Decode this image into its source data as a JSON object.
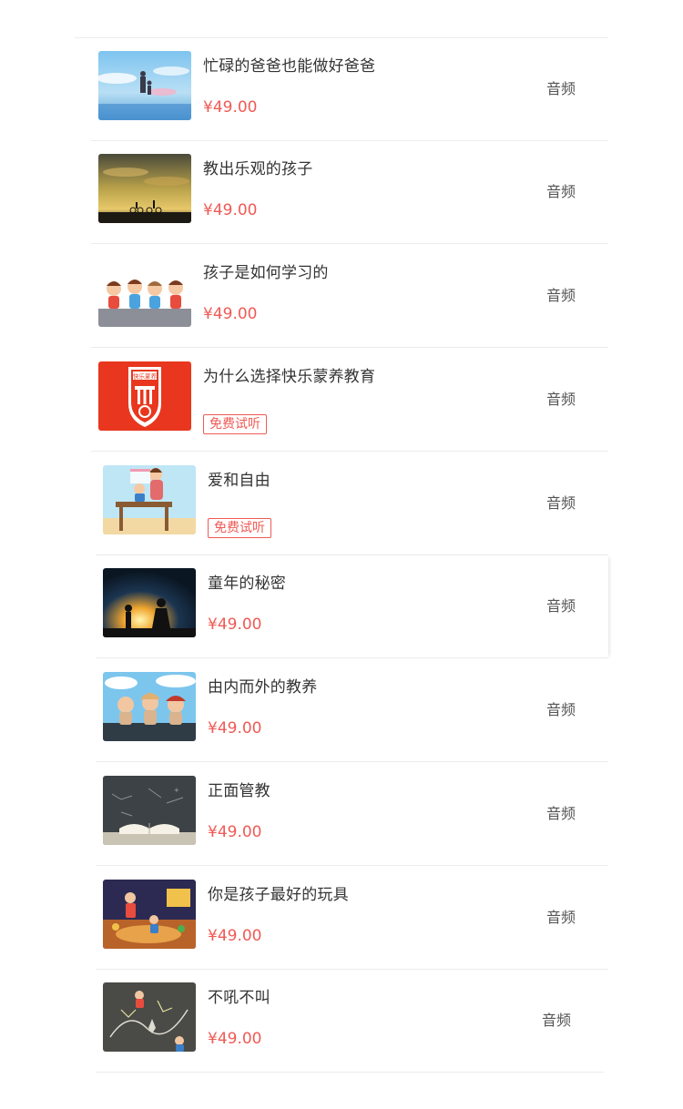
{
  "courses": [
    {
      "title": "忙碌的爸爸也能做好爸爸",
      "price": "¥49.00",
      "badge": null,
      "type": "音频",
      "thumb": "father-child-sky"
    },
    {
      "title": "教出乐观的孩子",
      "price": "¥49.00",
      "badge": null,
      "type": "音频",
      "thumb": "sunset-cyclists"
    },
    {
      "title": "孩子是如何学习的",
      "price": "¥49.00",
      "badge": null,
      "type": "音频",
      "thumb": "cartoon-kids"
    },
    {
      "title": "为什么选择快乐蒙养教育",
      "price": null,
      "badge": "免费试听",
      "type": "音频",
      "thumb": "kuaile-mengyang-logo",
      "logo_text": "快乐蒙养"
    },
    {
      "title": "爱和自由",
      "price": null,
      "badge": "免费试听",
      "type": "音频",
      "thumb": "mother-child-table"
    },
    {
      "title": "童年的秘密",
      "price": "¥49.00",
      "badge": null,
      "type": "音频",
      "thumb": "silhouette-night"
    },
    {
      "title": "由内而外的教养",
      "price": "¥49.00",
      "badge": null,
      "type": "音频",
      "thumb": "kids-on-wall"
    },
    {
      "title": "正面管教",
      "price": "¥49.00",
      "badge": null,
      "type": "音频",
      "thumb": "book-chalkboard"
    },
    {
      "title": "你是孩子最好的玩具",
      "price": "¥49.00",
      "badge": null,
      "type": "音频",
      "thumb": "playroom"
    },
    {
      "title": "不吼不叫",
      "price": "¥49.00",
      "badge": null,
      "type": "音频",
      "thumb": "chalk-drawing"
    }
  ],
  "colors": {
    "price": "#f05a55",
    "badge": "#f05a55",
    "divider": "#ececec"
  }
}
